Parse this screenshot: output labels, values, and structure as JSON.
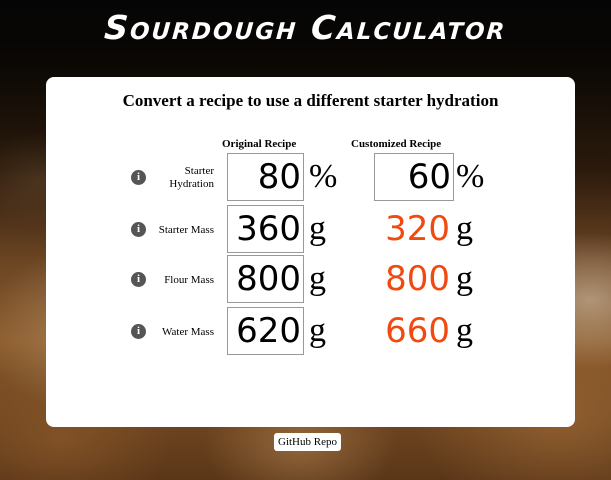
{
  "app": {
    "title": "Sourdough Calculator"
  },
  "card": {
    "heading": "Convert a recipe to use a different starter hydration",
    "columns": {
      "original": "Original Recipe",
      "customized": "Customized Recipe"
    }
  },
  "rows": [
    {
      "label": "Starter Hydration",
      "info_icon": "info-icon",
      "original_value": "80",
      "unit": "%",
      "custom_value": "60",
      "custom_editable": true
    },
    {
      "label": "Starter Mass",
      "info_icon": "info-icon",
      "original_value": "360",
      "unit": "g",
      "custom_value": "320",
      "custom_editable": false
    },
    {
      "label": "Flour Mass",
      "info_icon": "info-icon",
      "original_value": "800",
      "unit": "g",
      "custom_value": "800",
      "custom_editable": false
    },
    {
      "label": "Water Mass",
      "info_icon": "info-icon",
      "original_value": "620",
      "unit": "g",
      "custom_value": "660",
      "custom_editable": false
    }
  ],
  "footer": {
    "github_label": "GitHub Repo"
  },
  "colors": {
    "computed_value": "#f04a10",
    "card_background": "#ffffff",
    "page_background": "#000000"
  }
}
